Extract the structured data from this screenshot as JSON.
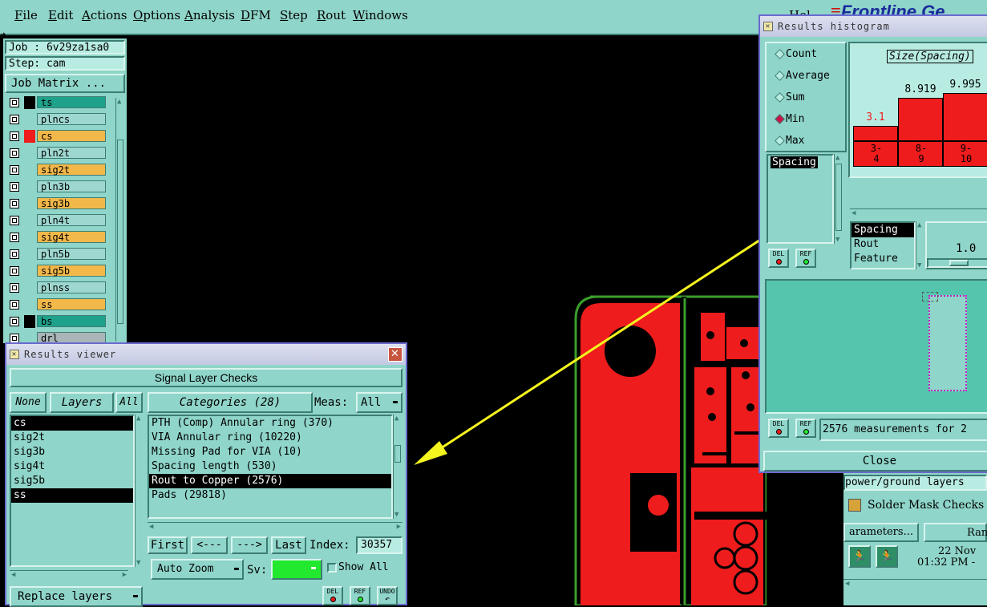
{
  "menubar": {
    "items": [
      {
        "label": "File",
        "underline": "F",
        "rest": "ile"
      },
      {
        "label": "Edit",
        "underline": "E",
        "rest": "dit"
      },
      {
        "label": "Actions",
        "underline": "A",
        "rest": "ctions"
      },
      {
        "label": "Options",
        "underline": "O",
        "rest": "ptions"
      },
      {
        "label": "Analysis",
        "underline": "A",
        "rest": "nalysis"
      },
      {
        "label": "DFM",
        "underline": "D",
        "rest": "FM"
      },
      {
        "label": "Step",
        "underline": "S",
        "rest": "tep"
      },
      {
        "label": "Rout",
        "underline": "R",
        "rest": "out"
      },
      {
        "label": "Windows",
        "underline": "W",
        "rest": "indows"
      }
    ],
    "help_partial": "Hel",
    "brand_partial": "Frontline",
    "brand_suffix": "Ge"
  },
  "left_panel": {
    "job": "Job : 6v29za1sa0",
    "step": "Step: cam",
    "job_matrix": "Job Matrix ...",
    "layers": [
      {
        "name": "ts",
        "color": "#1fa28c",
        "mark": "#000000"
      },
      {
        "name": "plncs",
        "color": "#9ed7cf",
        "mark": "#8fd5c9"
      },
      {
        "name": "cs",
        "color": "#f3b84a",
        "mark": "#ee1c1c"
      },
      {
        "name": "pln2t",
        "color": "#9ed7cf",
        "mark": "#8fd5c9"
      },
      {
        "name": "sig2t",
        "color": "#f3b84a",
        "mark": "#8fd5c9"
      },
      {
        "name": "pln3b",
        "color": "#9ed7cf",
        "mark": "#8fd5c9"
      },
      {
        "name": "sig3b",
        "color": "#f3b84a",
        "mark": "#8fd5c9"
      },
      {
        "name": "pln4t",
        "color": "#9ed7cf",
        "mark": "#8fd5c9"
      },
      {
        "name": "sig4t",
        "color": "#f3b84a",
        "mark": "#8fd5c9"
      },
      {
        "name": "pln5b",
        "color": "#9ed7cf",
        "mark": "#8fd5c9"
      },
      {
        "name": "sig5b",
        "color": "#f3b84a",
        "mark": "#8fd5c9"
      },
      {
        "name": "plnss",
        "color": "#9ed7cf",
        "mark": "#8fd5c9"
      },
      {
        "name": "ss",
        "color": "#f3b84a",
        "mark": "#8fd5c9"
      },
      {
        "name": "bs",
        "color": "#1fa28c",
        "mark": "#000000"
      },
      {
        "name": "drl",
        "color": "#a9b5b8",
        "mark": "#8fd5c9"
      }
    ]
  },
  "results_viewer": {
    "title": "Results viewer",
    "header": "Signal Layer Checks",
    "none_btn": "None",
    "layers_btn": "Layers",
    "all_btn": "All",
    "categories_btn": "Categories (28)",
    "meas_label": "Meas:",
    "meas_value": "All",
    "layers_list": [
      {
        "name": "cs",
        "selected": true
      },
      {
        "name": "sig2t",
        "selected": false
      },
      {
        "name": "sig3b",
        "selected": false
      },
      {
        "name": "sig4t",
        "selected": false
      },
      {
        "name": "sig5b",
        "selected": false
      },
      {
        "name": "ss",
        "selected": true
      }
    ],
    "categories_list": [
      {
        "name": "PTH (Comp) Annular ring (370)",
        "selected": false
      },
      {
        "name": "VIA Annular ring (10220)",
        "selected": false
      },
      {
        "name": "Missing Pad for VIA (10)",
        "selected": false
      },
      {
        "name": "Spacing length (530)",
        "selected": false
      },
      {
        "name": "Rout to Copper (2576)",
        "selected": true
      },
      {
        "name": "Pads (29818)",
        "selected": false
      }
    ],
    "first_btn": "First",
    "prev_btn": "<---",
    "next_btn": "--->",
    "last_btn": "Last",
    "index_label": "Index:",
    "index_value": "30357",
    "auto_zoom": "Auto Zoom",
    "sv_label": "Sv:",
    "sv_color": "#22e82e",
    "show_all": "Show All",
    "replace_layers": "Replace layers",
    "del": "DEL",
    "ref": "REF",
    "undo": "UNDO"
  },
  "histogram": {
    "title": "Results histogram",
    "radios": [
      {
        "label": "Count",
        "checked": false
      },
      {
        "label": "Average",
        "checked": false
      },
      {
        "label": "Sum",
        "checked": false
      },
      {
        "label": "Min",
        "checked": true
      },
      {
        "label": "Max",
        "checked": false
      }
    ],
    "chart_title": "Size(Spacing)",
    "fields_list": [
      "Spacing"
    ],
    "type_list": [
      {
        "name": "Spacing",
        "selected": true
      },
      {
        "name": "Rout",
        "selected": false
      },
      {
        "name": "Feature",
        "selected": false
      }
    ],
    "scale_value": "1.0",
    "status": "2576 measurements for 2",
    "close_btn": "Close",
    "del": "DEL",
    "ref": "REF"
  },
  "chart_data": {
    "type": "bar",
    "title": "Size(Spacing)",
    "categories": [
      "3-4",
      "8-9",
      "9-10"
    ],
    "category_labels": [
      [
        "3-",
        "4"
      ],
      [
        "8-",
        "9"
      ],
      [
        "9-",
        "10"
      ]
    ],
    "values": [
      3.1,
      8.919,
      9.995
    ],
    "value_labels": [
      "3.1",
      "8.919",
      "9.995"
    ],
    "highlight_color": "#ee1c1c",
    "ylim": [
      0,
      12
    ]
  },
  "right_bottom": {
    "layers_partial": "power/ground layers",
    "solder_mask": "Solder Mask Checks",
    "parameters_partial": "arameters...",
    "ranges_partial": "Ranges",
    "date_partial": "22 Nov",
    "time_partial": "01:32 PM -"
  }
}
